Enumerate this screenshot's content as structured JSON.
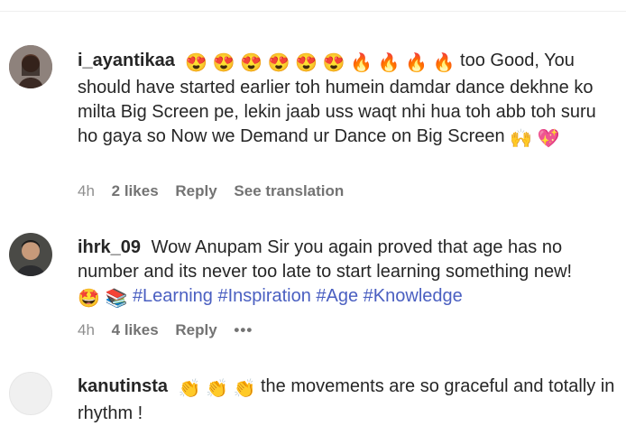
{
  "comments": [
    {
      "username": "i_ayantikaa",
      "emoji_prefix": "😍 😍 😍 😍 😍 😍 🔥 🔥 🔥 🔥",
      "text": "too Good, You should have started earlier toh humein damdar dance dekhne ko milta Big Screen pe, lekin jaab uss waqt nhi hua toh abb toh suru ho gaya so Now we Demand ur Dance on Big Screen",
      "emoji_suffix": "🙌 💖",
      "time": "4h",
      "likes": "2 likes",
      "reply": "Reply",
      "translate": "See translation"
    },
    {
      "username": "ihrk_09",
      "text": "Wow Anupam Sir you again proved that age has no number and its never too late to start learning something new!",
      "emoji_inline": "🤩 📚",
      "hashtags": "#Learning #Inspiration #Age #Knowledge",
      "time": "4h",
      "likes": "4 likes",
      "reply": "Reply",
      "more": "•••"
    },
    {
      "username": "kanutinsta",
      "emoji_prefix": "👏 👏 👏",
      "text": "the movements are so graceful and totally in rhythm !"
    }
  ]
}
